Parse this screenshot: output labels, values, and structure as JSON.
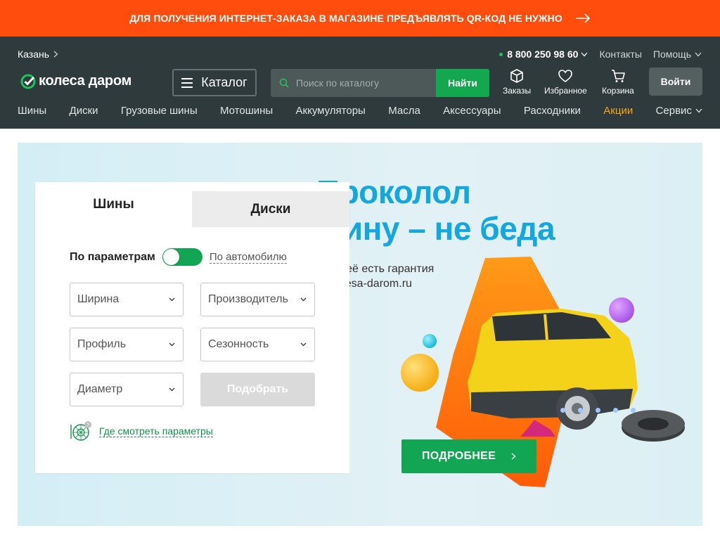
{
  "promo_banner": {
    "text": "ДЛЯ ПОЛУЧЕНИЯ ИНТЕРНЕТ-ЗАКАЗА В МАГАЗИНЕ ПРЕДЪЯВЛЯТЬ QR-КОД НЕ НУЖНО",
    "icon": "arrow-right-icon",
    "color": "#ff4d0d"
  },
  "header": {
    "city": "Казань",
    "phone": "8 800 250 98 60",
    "contacts": "Контакты",
    "help": "Помощь",
    "logo_text": "колеса даром",
    "catalog_label": "Каталог",
    "search": {
      "placeholder": "Поиск по каталогу",
      "value": "",
      "button": "Найти"
    },
    "quick_links": [
      {
        "label": "Заказы",
        "icon": "box-icon"
      },
      {
        "label": "Избранное",
        "icon": "heart-icon"
      },
      {
        "label": "Корзина",
        "icon": "cart-icon"
      }
    ],
    "login": "Войти",
    "background": "#2e3a3c",
    "accent": "#13a84f"
  },
  "nav": {
    "items": [
      "Шины",
      "Диски",
      "Грузовые шины",
      "Мотошины",
      "Аккумуляторы",
      "Масла",
      "Аксессуары",
      "Расходники",
      "Акции",
      "Сервис"
    ],
    "highlight_color": "#f7a51c"
  },
  "hero": {
    "title_line1": "Проколол",
    "title_line2": "шину – не беда",
    "subtitle_line1": "Для неё есть гарантия",
    "subtitle_line2": "от kolesa-darom.ru",
    "button": "ПОДРОБНЕЕ",
    "slides_count": 5,
    "title_color": "#13a6e0"
  },
  "filter": {
    "tabs": [
      "Шины",
      "Диски"
    ],
    "active_tab": "Шины",
    "mode_label": "По параметрам",
    "alt_mode": "По автомобилю",
    "selects": {
      "width": "Ширина",
      "maker": "Производитель",
      "profile": "Профиль",
      "season": "Сезонность",
      "diameter": "Диаметр"
    },
    "submit": "Подобрать",
    "where_link": "Где смотреть параметры"
  }
}
